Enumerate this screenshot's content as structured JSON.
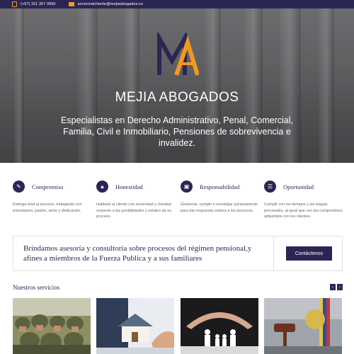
{
  "topbar": {
    "phone": "(+57) 311 357 0655",
    "email": "servicioalcliente@mejiaabogados.co",
    "phone_icon": "phone-icon",
    "email_icon": "envelope-icon"
  },
  "hero": {
    "logo_text": "MA",
    "brand": "MEJIA ABOGADOS",
    "tagline": "Especialistas en Derecho Administrativo, Penal, Comercial, Familia, Civil e Inmobiliario, Pensiones de sobrevivencia e invalidez."
  },
  "values": [
    {
      "title": "Compromiso",
      "icon": "pen-icon",
      "text": "Entrega total al proceso, trabajando con entusiasmo, pasión, amor y dedicación."
    },
    {
      "title": "Honestidad",
      "icon": "lock-icon",
      "text": "Hablarle al cliente con sinceridad y claridad respecto a las posibilidades y estatus de su proceso."
    },
    {
      "title": "Responsabilidad",
      "icon": "briefcase-icon",
      "text": "Gestionar, cumplir e investigar juiciosamente para dar respuesta certera a los procesos."
    },
    {
      "title": "Oportunidad",
      "icon": "document-icon",
      "text": "Cumplir con los tiempos y las etapas procesales, al igual que con los compromisos adquiridos con los clientes."
    }
  ],
  "cta": {
    "text": "Brindamos asesoría y consultoría sobre procesos del régimen pensional,y afines a miembros de la Fuerza Publica y a sus familiares",
    "button": "Contáctenos"
  },
  "services": {
    "title": "Nuestros servicios",
    "prev": "‹",
    "next": "›"
  },
  "colors": {
    "primary": "#2a2654",
    "accent": "#f29a1f"
  }
}
